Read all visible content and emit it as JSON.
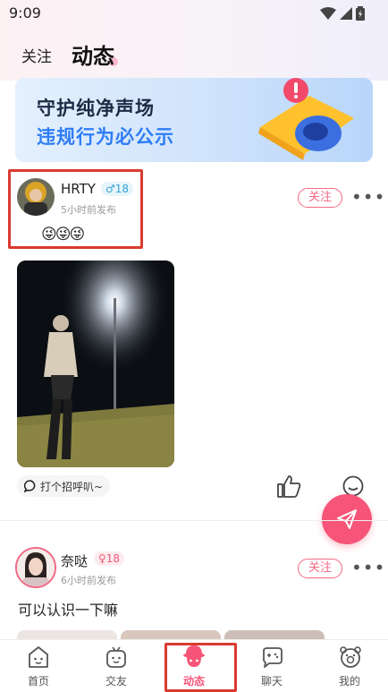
{
  "status_bar": {
    "time": "9:09"
  },
  "header": {
    "tabs": [
      {
        "label": "关注"
      },
      {
        "label": "动态",
        "active": true
      }
    ]
  },
  "banner": {
    "line1": "守护纯净声场",
    "line2": "违规行为必公示"
  },
  "posts": [
    {
      "username": "HRTY",
      "gender_symbol": "♂",
      "age": "18",
      "time": "5小时前发布",
      "emojis": "😜😜😜",
      "follow_label": "关注",
      "greet_label": "打个招呼叭~"
    },
    {
      "username": "奈哒",
      "gender_symbol": "♀",
      "age": "18",
      "time": "6小时前发布",
      "text": "可以认识一下嘛",
      "follow_label": "关注"
    }
  ],
  "bottom_nav": [
    {
      "label": "首页",
      "icon": "home-face-icon"
    },
    {
      "label": "交友",
      "icon": "tv-face-icon"
    },
    {
      "label": "动态",
      "icon": "feed-avatar-icon",
      "active": true
    },
    {
      "label": "聊天",
      "icon": "chat-gamepad-icon"
    },
    {
      "label": "我的",
      "icon": "profile-bear-icon"
    }
  ],
  "colors": {
    "accent": "#f65478",
    "male": "#39a3d8",
    "female": "#f05b7a",
    "highlight": "#d93b30"
  }
}
